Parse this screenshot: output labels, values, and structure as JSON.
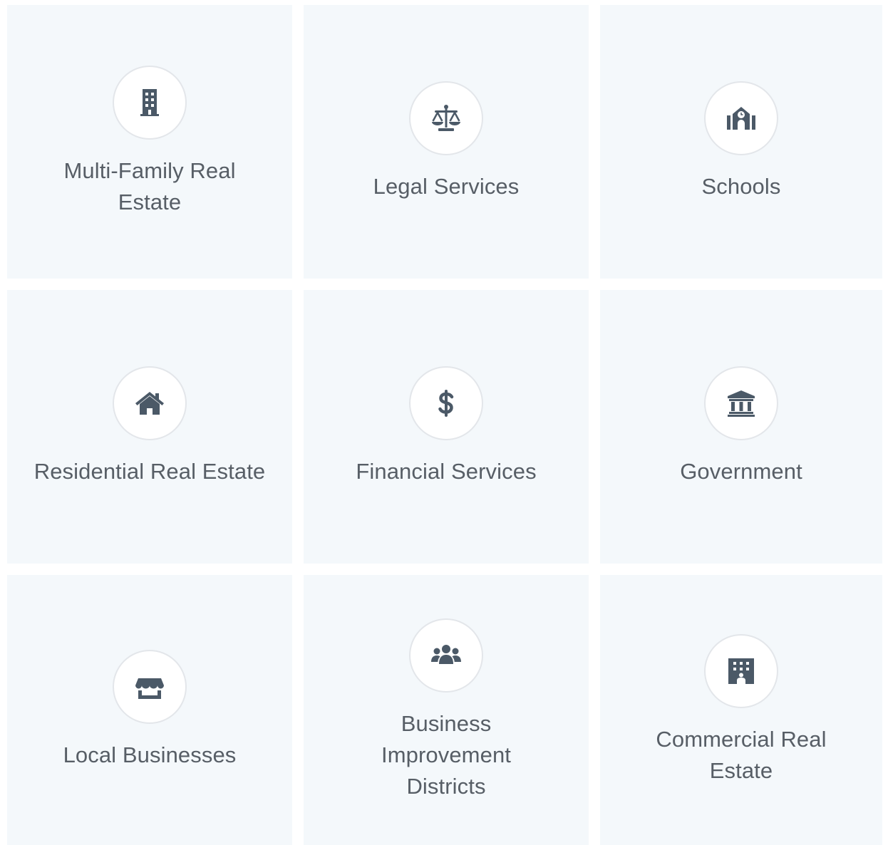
{
  "industries": [
    {
      "label": "Multi-Family Real Estate",
      "icon": "building-icon"
    },
    {
      "label": "Legal Services",
      "icon": "scale-icon"
    },
    {
      "label": "Schools",
      "icon": "school-icon"
    },
    {
      "label": "Residential Real Estate",
      "icon": "house-icon"
    },
    {
      "label": "Financial Services",
      "icon": "dollar-icon"
    },
    {
      "label": "Government",
      "icon": "government-building-icon"
    },
    {
      "label": "Local Businesses",
      "icon": "storefront-icon"
    },
    {
      "label": "Business Improvement Districts",
      "icon": "people-group-icon"
    },
    {
      "label": "Commercial Real Estate",
      "icon": "office-building-icon"
    }
  ],
  "colors": {
    "card_background": "#f4f8fb",
    "icon": "#4b5967",
    "text": "#575e66",
    "circle_border": "#e3e6ea"
  }
}
